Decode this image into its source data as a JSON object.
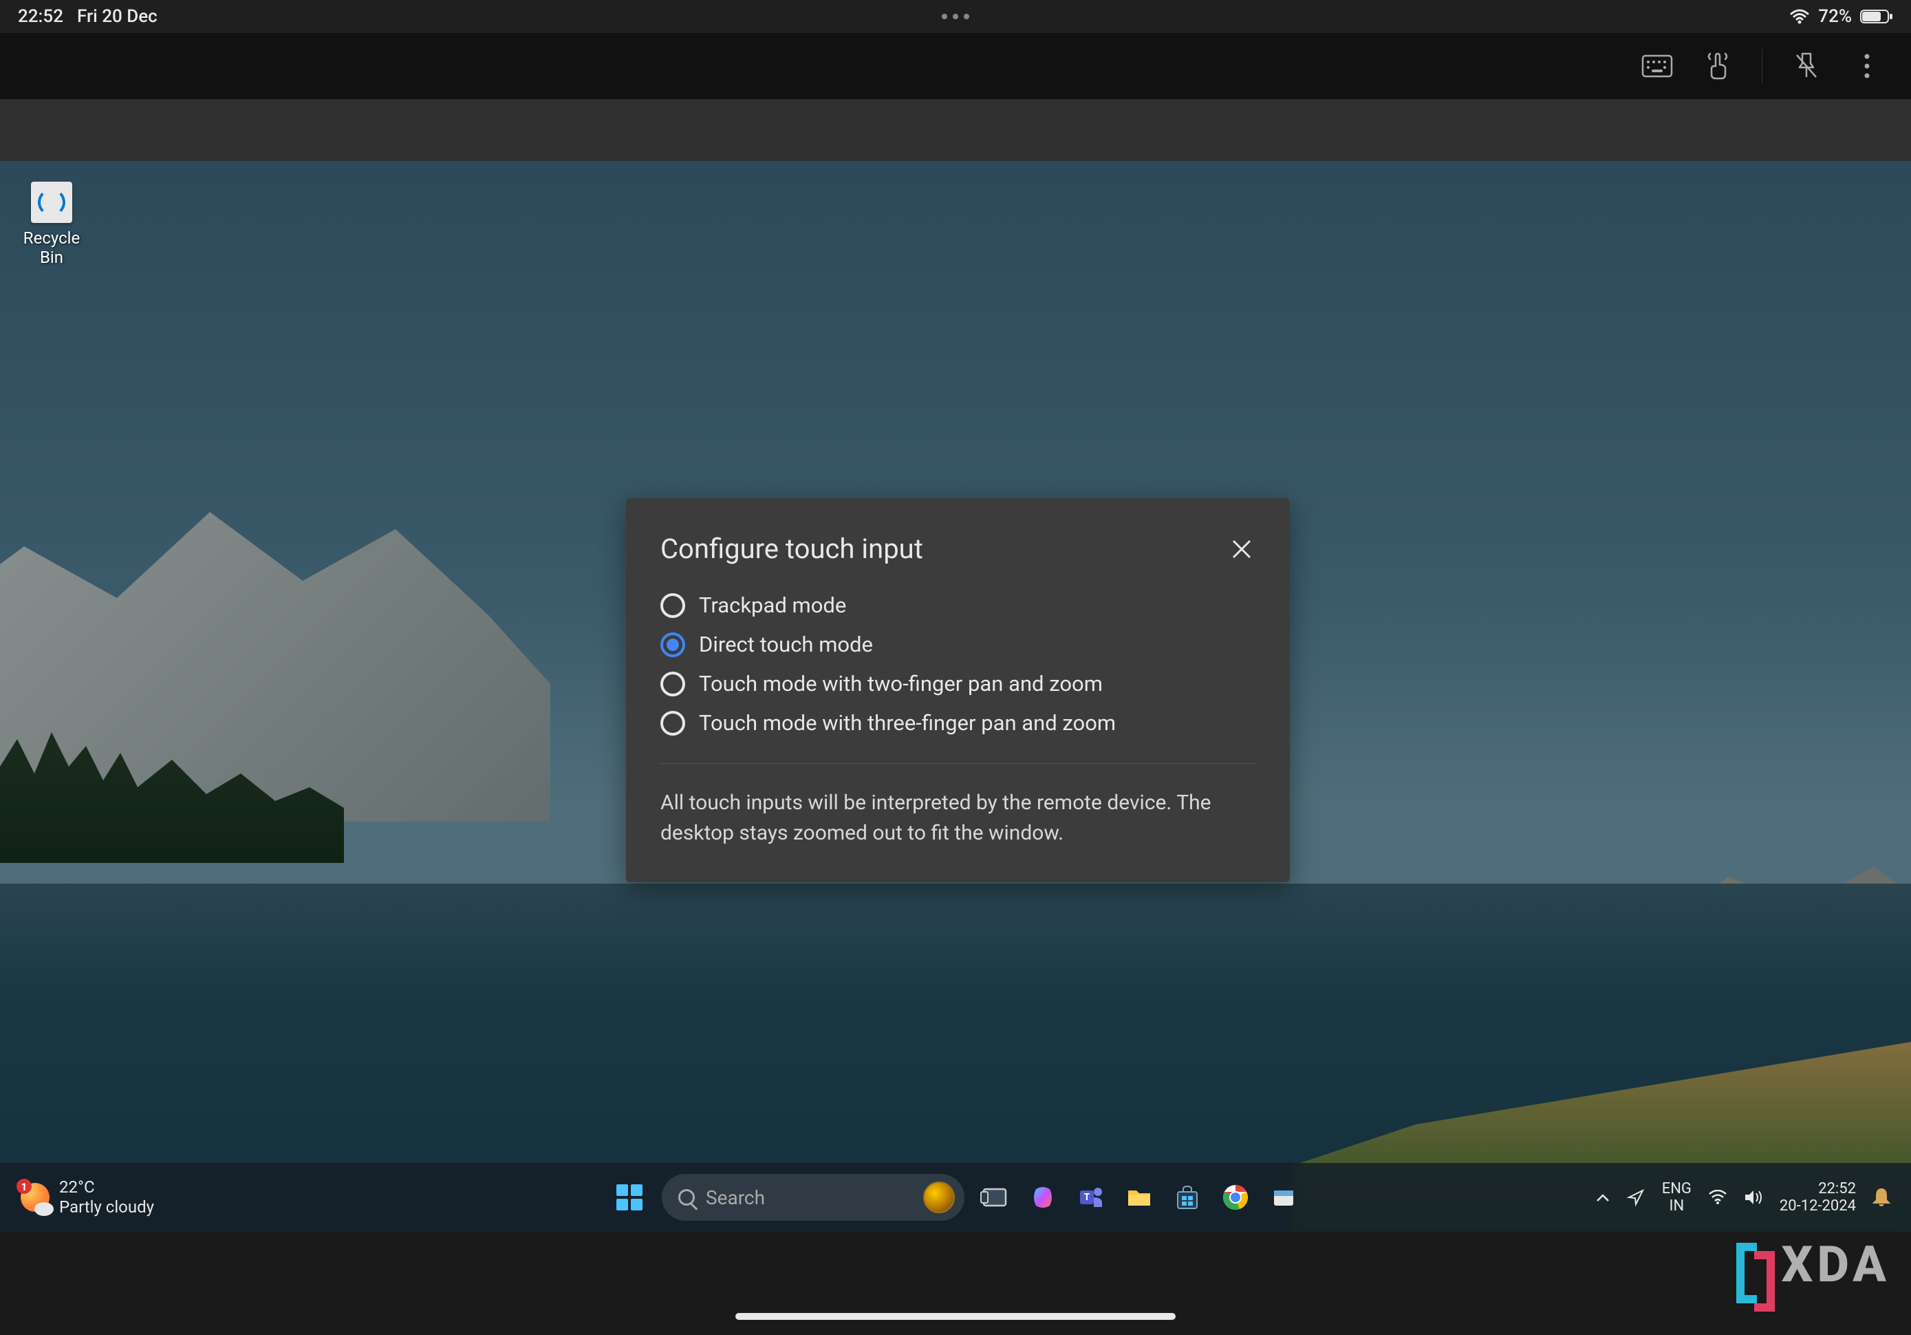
{
  "ipad_status": {
    "time": "22:52",
    "date": "Fri 20 Dec",
    "battery_pct": "72%"
  },
  "app_toolbar": {
    "icons": [
      "keyboard-icon",
      "touch-icon",
      "pin-off-icon",
      "more-vert-icon"
    ]
  },
  "desktop": {
    "recycle_bin_label": "Recycle Bin"
  },
  "modal": {
    "title": "Configure touch input",
    "options": [
      {
        "label": "Trackpad mode",
        "selected": false
      },
      {
        "label": "Direct touch mode",
        "selected": true
      },
      {
        "label": "Touch mode with two-finger pan and zoom",
        "selected": false
      },
      {
        "label": "Touch mode with three-finger pan and zoom",
        "selected": false
      }
    ],
    "description": "All touch inputs will be interpreted by the remote device. The desktop stays zoomed out to fit the window."
  },
  "taskbar": {
    "weather": {
      "temp": "22°C",
      "condition": "Partly cloudy",
      "badge": "1"
    },
    "search_placeholder": "Search",
    "apps": [
      "task-view-icon",
      "copilot-icon",
      "teams-icon",
      "explorer-icon",
      "store-icon",
      "chrome-icon",
      "mail-icon"
    ],
    "lang_top": "ENG",
    "lang_bottom": "IN",
    "time": "22:52",
    "date_short": "20-12-2024"
  },
  "watermark": {
    "text": "XDA"
  }
}
